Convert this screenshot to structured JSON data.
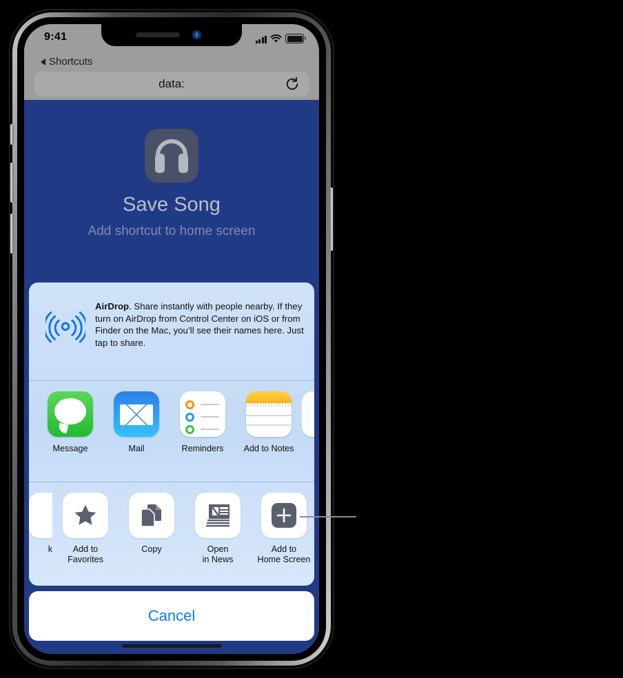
{
  "status_bar": {
    "time": "9:41",
    "signal_icon": "cellular-bars-icon",
    "wifi_icon": "wifi-icon",
    "battery_icon": "battery-full-icon"
  },
  "browser": {
    "back_label": "Shortcuts",
    "back_icon": "back-triangle-icon",
    "url_value": "data:",
    "reload_icon": "reload-icon"
  },
  "hero": {
    "icon": "headphones-icon",
    "title": "Save Song",
    "subtitle": "Add shortcut to home screen"
  },
  "airdrop": {
    "icon": "airdrop-icon",
    "title": "AirDrop",
    "body": ". Share instantly with people nearby. If they turn on AirDrop from Control Center on iOS or from Finder on the Mac, you’ll see their names here. Just tap to share."
  },
  "apps": [
    {
      "label": "Message",
      "icon": "messages-app-icon"
    },
    {
      "label": "Mail",
      "icon": "mail-app-icon"
    },
    {
      "label": "Reminders",
      "icon": "reminders-app-icon"
    },
    {
      "label": "Add to Notes",
      "icon": "notes-app-icon"
    },
    {
      "label": "",
      "icon": "partial-app-icon"
    }
  ],
  "actions": [
    {
      "label": "k",
      "icon": "bookmark-partial-icon"
    },
    {
      "label": "Add to\nFavorites",
      "icon": "star-icon"
    },
    {
      "label": "Copy",
      "icon": "copy-icon"
    },
    {
      "label": "Open\nin News",
      "icon": "news-icon"
    },
    {
      "label": "Add to\nHome Screen",
      "icon": "plus-icon"
    }
  ],
  "cancel": {
    "label": "Cancel"
  },
  "colors": {
    "header_blue": "#213A85",
    "card_blue": "#CFE2F8",
    "cancel_text": "#0A7CFF",
    "chrome_gray": "#9D9D9D",
    "icon_gray": "#5A5F6E"
  }
}
